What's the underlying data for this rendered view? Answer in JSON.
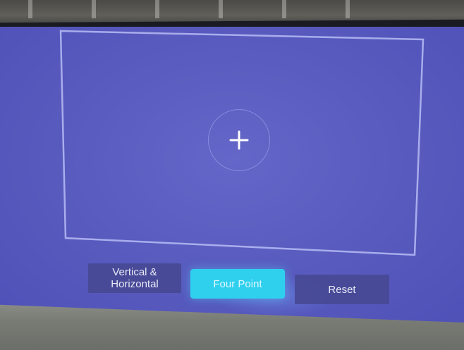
{
  "keystone_menu": {
    "buttons": {
      "vertical_horizontal": "Vertical & Horizontal",
      "four_point": "Four Point",
      "reset": "Reset"
    },
    "selected": "four_point"
  },
  "icons": {
    "center_handle": "plus-icon"
  },
  "colors": {
    "projection_background": "#5a5cbf",
    "frame_outline": "#b7bcf4",
    "button_default": "#484a96",
    "button_active": "#2fd0ee"
  }
}
